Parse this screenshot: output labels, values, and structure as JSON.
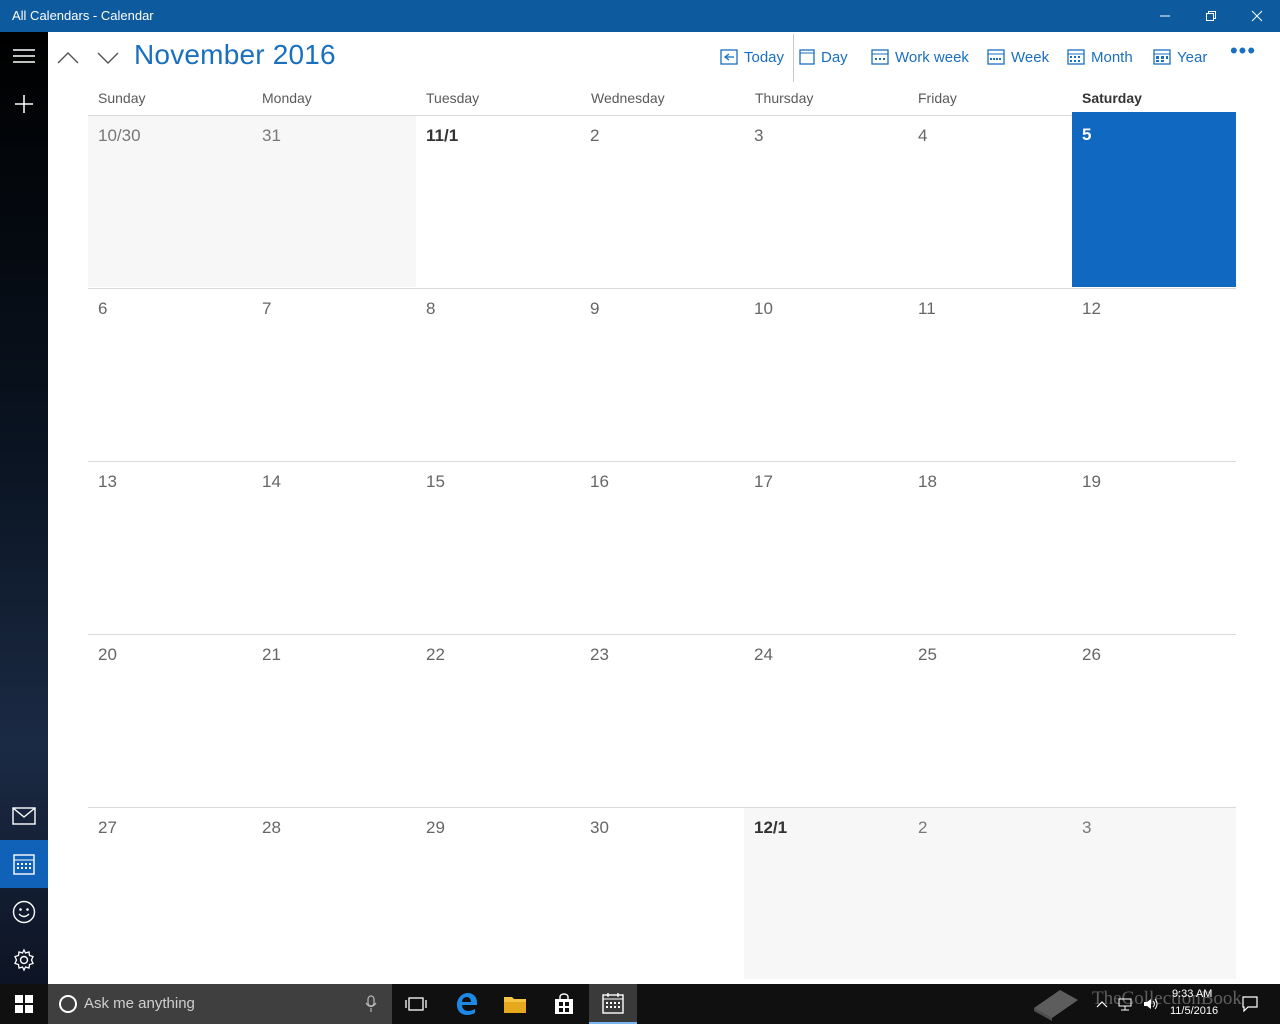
{
  "window": {
    "title": "All Calendars - Calendar"
  },
  "toolbar": {
    "month_title": "November 2016",
    "today_label": "Today",
    "day_label": "Day",
    "workweek_label": "Work week",
    "week_label": "Week",
    "month_label": "Month",
    "year_label": "Year",
    "more_label": "•••"
  },
  "weekdays": [
    "Sunday",
    "Monday",
    "Tuesday",
    "Wednesday",
    "Thursday",
    "Friday",
    "Saturday"
  ],
  "weeks": [
    [
      "10/30",
      "31",
      "11/1",
      "2",
      "3",
      "4",
      "5"
    ],
    [
      "6",
      "7",
      "8",
      "9",
      "10",
      "11",
      "12"
    ],
    [
      "13",
      "14",
      "15",
      "16",
      "17",
      "18",
      "19"
    ],
    [
      "20",
      "21",
      "22",
      "23",
      "24",
      "25",
      "26"
    ],
    [
      "27",
      "28",
      "29",
      "30",
      "12/1",
      "2",
      "3"
    ]
  ],
  "taskbar": {
    "search_placeholder": "Ask me anything",
    "clock_time": "9:33 AM",
    "clock_date": "11/5/2016",
    "watermark": "TheCollectionBook"
  },
  "colors": {
    "accent": "#1068c0",
    "titlebar": "#0e5a9e",
    "title_text": "#1a6fbf"
  }
}
